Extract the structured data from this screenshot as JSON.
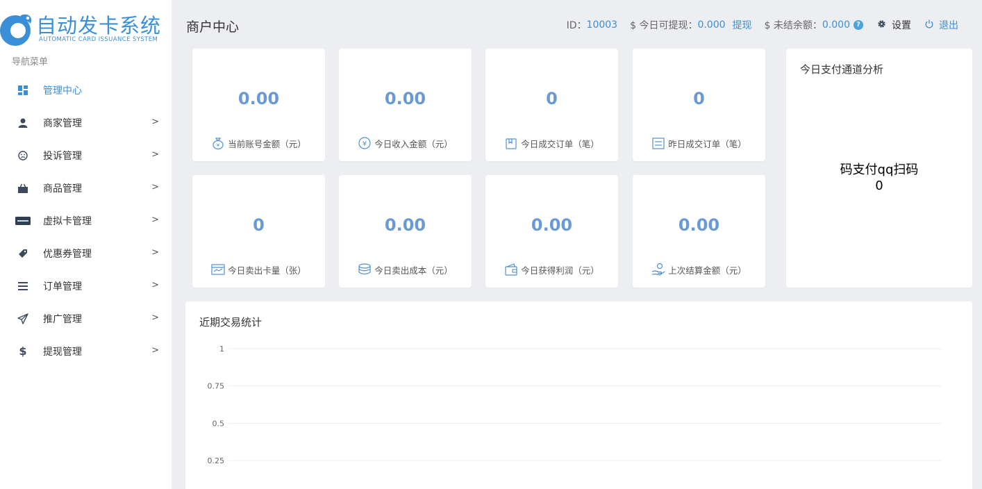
{
  "brand": {
    "title": "自动发卡系统",
    "subtitle": "AUTOMATIC CARD ISSUANCE SYSTEM"
  },
  "sidebar": {
    "nav_title": "导航菜单",
    "items": [
      {
        "label": "管理中心",
        "icon": "dashboard-icon"
      },
      {
        "label": "商家管理",
        "icon": "user-icon"
      },
      {
        "label": "投诉管理",
        "icon": "frown-icon"
      },
      {
        "label": "商品管理",
        "icon": "shopping-bag-icon"
      },
      {
        "label": "虚拟卡管理",
        "icon": "credit-card-icon"
      },
      {
        "label": "优惠券管理",
        "icon": "ticket-icon"
      },
      {
        "label": "订单管理",
        "icon": "list-icon"
      },
      {
        "label": "推广管理",
        "icon": "paper-plane-icon"
      },
      {
        "label": "提现管理",
        "icon": "dollar-icon"
      }
    ]
  },
  "header": {
    "page_title": "商户中心",
    "id_label": "ID：",
    "id_value": "10003",
    "withdrawable_label": "$ 今日可提现：",
    "withdrawable_value": "0.000",
    "withdraw_link": "提现",
    "unsettled_label": "$ 未结余额：",
    "unsettled_value": "0.000",
    "help_mark": "?",
    "settings_label": "设置",
    "logout_label": "退出"
  },
  "stats": [
    {
      "value": "0.00",
      "label": "当前账号金额（元）",
      "icon": "money-bag-icon"
    },
    {
      "value": "0.00",
      "label": "今日收入金额（元）",
      "icon": "yen-coin-icon"
    },
    {
      "value": "0",
      "label": "今日成交订单（笔）",
      "icon": "order-bag-icon"
    },
    {
      "value": "0",
      "label": "昨日成交订单（笔）",
      "icon": "receipt-icon"
    },
    {
      "value": "0",
      "label": "今日卖出卡量（张）",
      "icon": "card-icon"
    },
    {
      "value": "0.00",
      "label": "今日卖出成本（元）",
      "icon": "coin-stack-icon"
    },
    {
      "value": "0.00",
      "label": "今日获得利润（元）",
      "icon": "wallet-icon"
    },
    {
      "value": "0.00",
      "label": "上次结算金额（元）",
      "icon": "hand-money-icon"
    }
  ],
  "payment_panel": {
    "title": "今日支付通道分析",
    "channel_name": "码支付qq扫码",
    "channel_value": "0"
  },
  "trend_panel": {
    "title": "近期交易统计"
  },
  "colors": {
    "accent": "#3a8fd6",
    "stat_value": "#6a9ad6",
    "background": "#edeef2"
  },
  "chart_data": {
    "type": "line",
    "title": "近期交易统计",
    "xlabel": "",
    "ylabel": "",
    "ylim": [
      0,
      1
    ],
    "y_ticks": [
      "1",
      "0.75",
      "0.5",
      "0.25"
    ],
    "y_tick_values": [
      1,
      0.75,
      0.5,
      0.25
    ],
    "series": [],
    "grid": true
  }
}
